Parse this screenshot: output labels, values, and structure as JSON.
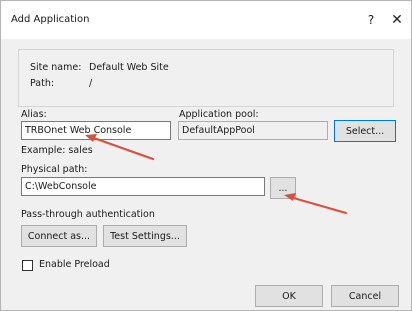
{
  "window": {
    "title": "Add Application",
    "help_glyph": "?",
    "close_glyph": "✕"
  },
  "site_info": {
    "site_name_label": "Site name:",
    "site_name_value": "Default Web Site",
    "path_label": "Path:",
    "path_value": "/"
  },
  "alias": {
    "label": "Alias:",
    "value": "TRBOnet Web Console",
    "example": "Example: sales"
  },
  "app_pool": {
    "label": "Application pool:",
    "value": "DefaultAppPool",
    "select_button": "Select..."
  },
  "physical_path": {
    "label": "Physical path:",
    "value": "C:\\WebConsole",
    "browse_button": "..."
  },
  "passthrough": {
    "label": "Pass-through authentication",
    "connect_as_button": "Connect as...",
    "test_settings_button": "Test Settings..."
  },
  "preload": {
    "label": "Enable Preload",
    "checked": false
  },
  "footer": {
    "ok_button": "OK",
    "cancel_button": "Cancel"
  },
  "colors": {
    "annotation_arrow": "#d9503c",
    "default_button_border": "#0078d7"
  }
}
